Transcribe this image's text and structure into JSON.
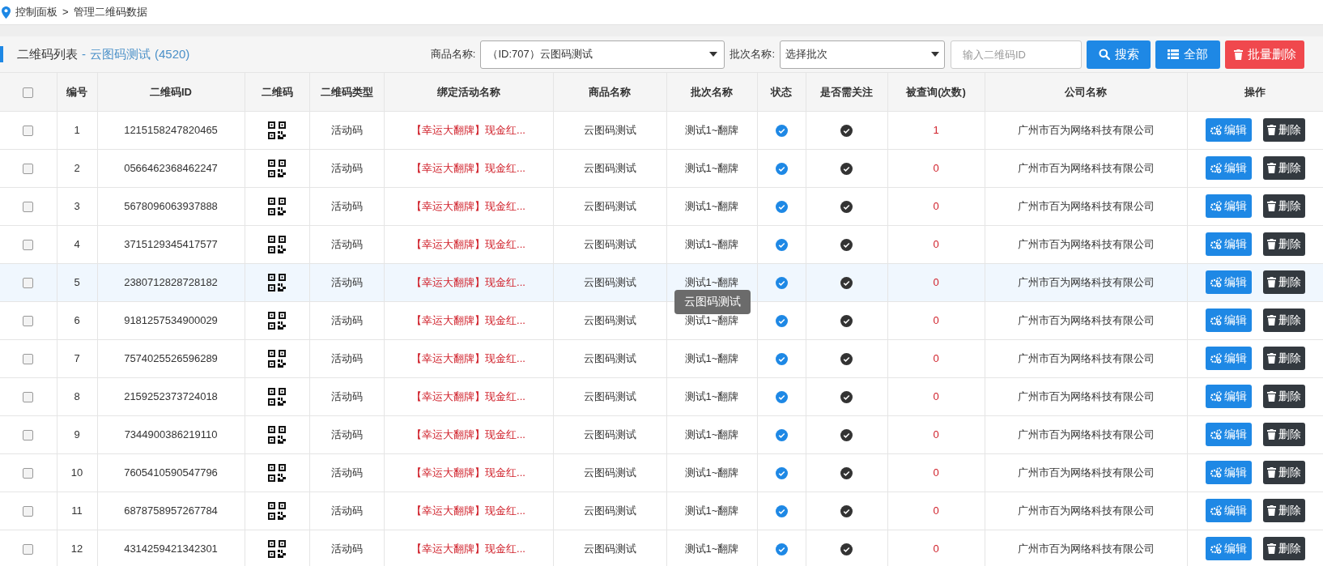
{
  "breadcrumb": [
    "控制面板",
    "管理二维码数据"
  ],
  "breadcrumb_separator": ">",
  "list_header": {
    "title": "二维码列表",
    "separator": "-",
    "product": "云图码测试",
    "count": "(4520)"
  },
  "filters": {
    "product_label": "商品名称:",
    "product_value": "（ID:707）云图码测试",
    "batch_label": "批次名称:",
    "batch_value": "选择批次",
    "search_placeholder": "输入二维码ID"
  },
  "buttons": [
    {
      "kind": "search",
      "label": "搜索"
    },
    {
      "kind": "all",
      "label": "全部"
    },
    {
      "kind": "bulk_delete",
      "label": "批量删除"
    }
  ],
  "table": {
    "select_all_checked": false,
    "columns": [
      "编号",
      "二维码ID",
      "二维码",
      "二维码类型",
      "绑定活动名称",
      "商品名称",
      "批次名称",
      "状态",
      "是否需关注",
      "被查询(次数)",
      "公司名称",
      "操作"
    ],
    "rows": [
      {
        "no": "1",
        "qr_id": "1215158247820465",
        "type": "活动码",
        "activity": "【幸运大翻牌】现金红...",
        "product": "云图码测试",
        "batch": "测试1~翻牌",
        "enabled": true,
        "attention": true,
        "queries": "1",
        "company": "广州市百为网络科技有限公司",
        "checked": false,
        "highlighted": false,
        "edit_label": "编辑",
        "delete_label": "删除"
      },
      {
        "no": "2",
        "qr_id": "0566462368462247",
        "type": "活动码",
        "activity": "【幸运大翻牌】现金红...",
        "product": "云图码测试",
        "batch": "测试1~翻牌",
        "enabled": true,
        "attention": true,
        "queries": "0",
        "company": "广州市百为网络科技有限公司",
        "checked": false,
        "highlighted": false,
        "edit_label": "编辑",
        "delete_label": "删除"
      },
      {
        "no": "3",
        "qr_id": "5678096063937888",
        "type": "活动码",
        "activity": "【幸运大翻牌】现金红...",
        "product": "云图码测试",
        "batch": "测试1~翻牌",
        "enabled": true,
        "attention": true,
        "queries": "0",
        "company": "广州市百为网络科技有限公司",
        "checked": false,
        "highlighted": false,
        "edit_label": "编辑",
        "delete_label": "删除"
      },
      {
        "no": "4",
        "qr_id": "3715129345417577",
        "type": "活动码",
        "activity": "【幸运大翻牌】现金红...",
        "product": "云图码测试",
        "batch": "测试1~翻牌",
        "enabled": true,
        "attention": true,
        "queries": "0",
        "company": "广州市百为网络科技有限公司",
        "checked": false,
        "highlighted": false,
        "edit_label": "编辑",
        "delete_label": "删除"
      },
      {
        "no": "5",
        "qr_id": "2380712828728182",
        "type": "活动码",
        "activity": "【幸运大翻牌】现金红...",
        "product": "云图码测试",
        "batch": "测试1~翻牌",
        "enabled": true,
        "attention": true,
        "queries": "0",
        "company": "广州市百为网络科技有限公司",
        "checked": false,
        "highlighted": true,
        "edit_label": "编辑",
        "delete_label": "删除",
        "tooltip": "云图码测试"
      },
      {
        "no": "6",
        "qr_id": "9181257534900029",
        "type": "活动码",
        "activity": "【幸运大翻牌】现金红...",
        "product": "云图码测试",
        "batch": "测试1~翻牌",
        "enabled": true,
        "attention": true,
        "queries": "0",
        "company": "广州市百为网络科技有限公司",
        "checked": false,
        "highlighted": false,
        "edit_label": "编辑",
        "delete_label": "删除"
      },
      {
        "no": "7",
        "qr_id": "7574025526596289",
        "type": "活动码",
        "activity": "【幸运大翻牌】现金红...",
        "product": "云图码测试",
        "batch": "测试1~翻牌",
        "enabled": true,
        "attention": true,
        "queries": "0",
        "company": "广州市百为网络科技有限公司",
        "checked": false,
        "highlighted": false,
        "edit_label": "编辑",
        "delete_label": "删除"
      },
      {
        "no": "8",
        "qr_id": "2159252373724018",
        "type": "活动码",
        "activity": "【幸运大翻牌】现金红...",
        "product": "云图码测试",
        "batch": "测试1~翻牌",
        "enabled": true,
        "attention": true,
        "queries": "0",
        "company": "广州市百为网络科技有限公司",
        "checked": false,
        "highlighted": false,
        "edit_label": "编辑",
        "delete_label": "删除"
      },
      {
        "no": "9",
        "qr_id": "7344900386219110",
        "type": "活动码",
        "activity": "【幸运大翻牌】现金红...",
        "product": "云图码测试",
        "batch": "测试1~翻牌",
        "enabled": true,
        "attention": true,
        "queries": "0",
        "company": "广州市百为网络科技有限公司",
        "checked": false,
        "highlighted": false,
        "edit_label": "编辑",
        "delete_label": "删除"
      },
      {
        "no": "10",
        "qr_id": "7605410590547796",
        "type": "活动码",
        "activity": "【幸运大翻牌】现金红...",
        "product": "云图码测试",
        "batch": "测试1~翻牌",
        "enabled": true,
        "attention": true,
        "queries": "0",
        "company": "广州市百为网络科技有限公司",
        "checked": false,
        "highlighted": false,
        "edit_label": "编辑",
        "delete_label": "删除"
      },
      {
        "no": "11",
        "qr_id": "6878758957267784",
        "type": "活动码",
        "activity": "【幸运大翻牌】现金红...",
        "product": "云图码测试",
        "batch": "测试1~翻牌",
        "enabled": true,
        "attention": true,
        "queries": "0",
        "company": "广州市百为网络科技有限公司",
        "checked": false,
        "highlighted": false,
        "edit_label": "编辑",
        "delete_label": "删除"
      },
      {
        "no": "12",
        "qr_id": "4314259421342301",
        "type": "活动码",
        "activity": "【幸运大翻牌】现金红...",
        "product": "云图码测试",
        "batch": "测试1~翻牌",
        "enabled": true,
        "attention": true,
        "queries": "0",
        "company": "广州市百为网络科技有限公司",
        "checked": false,
        "highlighted": false,
        "edit_label": "编辑",
        "delete_label": "删除"
      }
    ]
  }
}
